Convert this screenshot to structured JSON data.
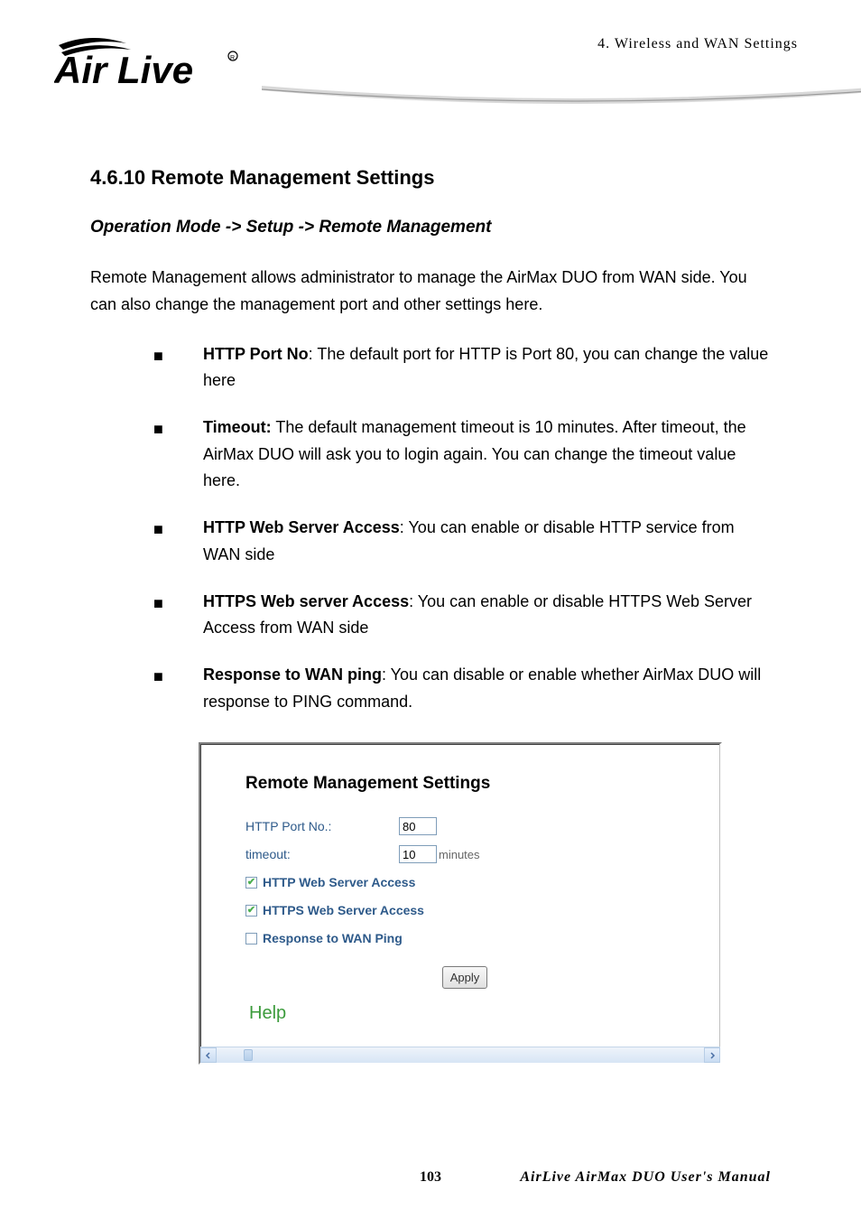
{
  "header": {
    "section_label": "4.  Wireless  and  WAN  Settings",
    "logo_alt": "Air Live"
  },
  "doc": {
    "heading": "4.6.10 Remote Management Settings",
    "breadcrumb": "Operation Mode -> Setup -> Remote Management",
    "intro": "Remote Management allows administrator to manage the AirMax DUO from WAN side. You can also change the management port and other settings here.",
    "bullets": [
      {
        "term": "HTTP Port No",
        "desc": ": The default port for HTTP is Port 80, you can change the value here"
      },
      {
        "term": "Timeout:",
        "desc": " The default management timeout is 10 minutes. After timeout, the AirMax DUO will ask you to login again. You can change the timeout value here."
      },
      {
        "term": "HTTP Web Server Access",
        "desc": ": You can enable or disable HTTP service from WAN side"
      },
      {
        "term": "HTTPS Web server Access",
        "desc": ": You can enable or disable HTTPS Web Server Access from WAN side"
      },
      {
        "term": "Response to WAN ping",
        "desc": ": You can disable or enable whether AirMax DUO will response to PING command."
      }
    ]
  },
  "panel": {
    "title": "Remote Management Settings",
    "http_port_label": "HTTP Port No.:",
    "http_port_value": "80",
    "timeout_label": "timeout:",
    "timeout_value": "10",
    "timeout_unit": "minutes",
    "cb_http": "HTTP Web Server Access",
    "cb_https": "HTTPS Web Server Access",
    "cb_wanping": "Response to WAN Ping",
    "http_checked": true,
    "https_checked": true,
    "wanping_checked": false,
    "apply_label": "Apply",
    "help_label": "Help"
  },
  "footer": {
    "page": "103",
    "manual": "AirLive  AirMax  DUO  User's  Manual"
  }
}
